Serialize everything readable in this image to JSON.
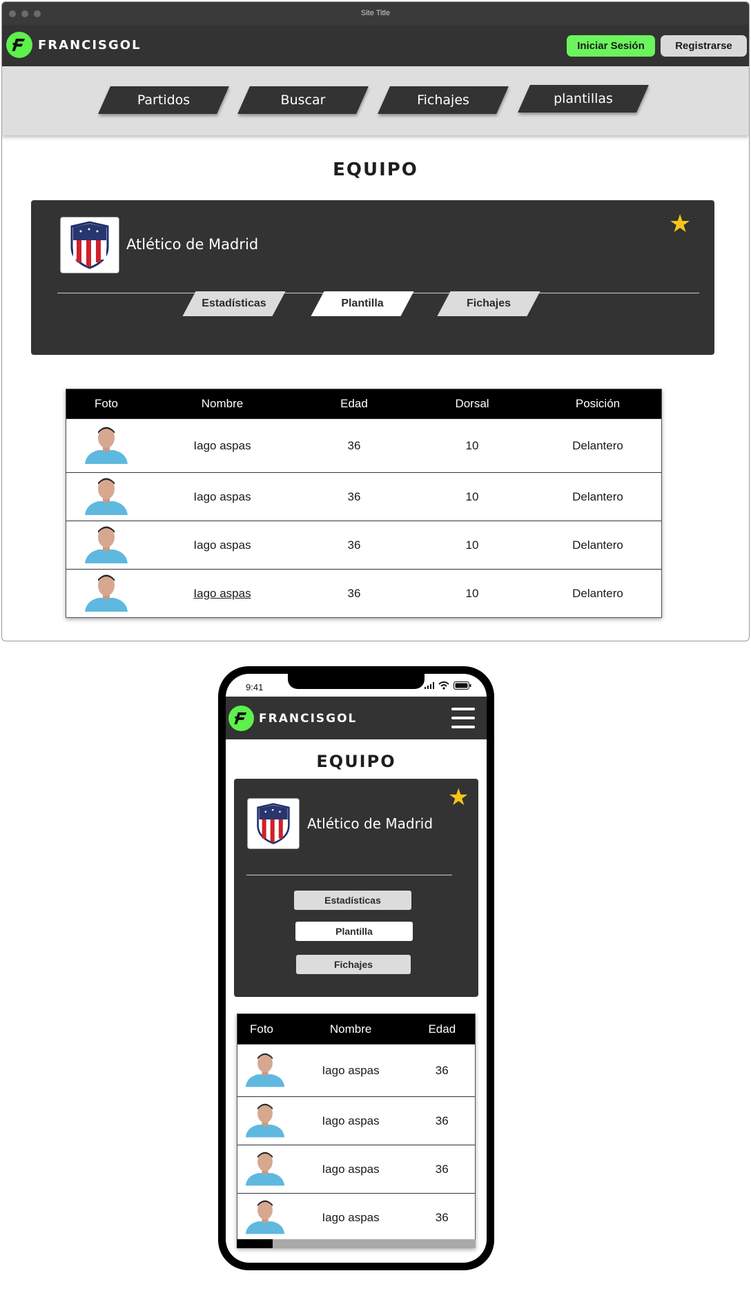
{
  "browser": {
    "title": "Site Title"
  },
  "brand": {
    "name": "FRANCISGOL"
  },
  "auth": {
    "login_label": "Iniciar Sesión",
    "register_label": "Registrarse"
  },
  "nav": {
    "items": [
      {
        "label": "Partidos"
      },
      {
        "label": "Buscar"
      },
      {
        "label": "Fichajes"
      },
      {
        "label": "plantillas"
      }
    ]
  },
  "page": {
    "title": "EQUIPO"
  },
  "team": {
    "name": "Atlético de Madrid",
    "favorite_icon": "star-icon",
    "crest_icon": "club-crest-icon",
    "tabs": [
      {
        "label": "Estadísticas"
      },
      {
        "label": "Plantilla",
        "active": true
      },
      {
        "label": "Fichajes"
      }
    ]
  },
  "roster": {
    "columns": [
      "Foto",
      "Nombre",
      "Edad",
      "Dorsal",
      "Posición"
    ],
    "rows": [
      {
        "name": "Iago aspas",
        "age": "36",
        "number": "10",
        "position": "Delantero"
      },
      {
        "name": "Iago aspas",
        "age": "36",
        "number": "10",
        "position": "Delantero"
      },
      {
        "name": "Iago aspas",
        "age": "36",
        "number": "10",
        "position": "Delantero"
      },
      {
        "name": "Iago aspas",
        "age": "36",
        "number": "10",
        "position": "Delantero"
      }
    ]
  },
  "mobile": {
    "time": "9:41",
    "columns": [
      "Foto",
      "Nombre",
      "Edad"
    ],
    "rows": [
      {
        "name": "Iago aspas",
        "age": "36"
      },
      {
        "name": "Iago aspas",
        "age": "36"
      },
      {
        "name": "Iago aspas",
        "age": "36"
      },
      {
        "name": "Iago aspas",
        "age": "36"
      }
    ],
    "scroll_fraction": 0.15
  },
  "colors": {
    "accent_green": "#5ef04d",
    "dark": "#333333",
    "star": "#f5c518"
  }
}
